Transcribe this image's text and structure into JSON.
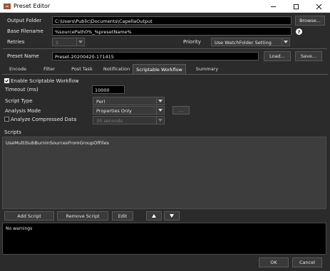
{
  "window": {
    "title": "Preset Editor"
  },
  "form": {
    "output_folder_label": "Output Folder",
    "output_folder_value": "C:\\Users\\Public\\Documents\\CapellaOutput",
    "browse_label": "Browse...",
    "base_filename_label": "Base Filename",
    "base_filename_value": "%sourcePath0%_%presetName%",
    "retries_label": "Retries",
    "retries_value": "2",
    "priority_label": "Priority",
    "priority_value": "Use WatchFolder Setting",
    "preset_name_label": "Preset Name",
    "preset_name_value": "Preset-20200420-171415",
    "load_label": "Load...",
    "save_label": "Save..."
  },
  "tabs": [
    "Encode",
    "Filter",
    "Post Task",
    "Notification",
    "Scriptable Workflow",
    "Summary"
  ],
  "active_tab": "Scriptable Workflow",
  "scriptable": {
    "enable_label": "Enable Scriptable Workflow",
    "enable_checked": true,
    "timeout_label": "Timeout (ms)",
    "timeout_value": "10000",
    "script_type_label": "Script Type",
    "script_type_value": "Perl",
    "analysis_mode_label": "Analysis Mode",
    "analysis_mode_value": "Properties Only",
    "analysis_more_label": "...",
    "analyze_compressed_label": "Analyze Compressed Data",
    "analyze_compressed_checked": false,
    "analyze_duration_value": "30 seconds",
    "scripts_label": "Scripts",
    "scripts": [
      "UseMultiSubBurnInSourcesFromGroupOfFiles"
    ],
    "add_script_label": "Add Script",
    "remove_script_label": "Remove Script",
    "edit_label": "Edit",
    "log_message": "No warnings"
  },
  "footer": {
    "ok_label": "OK",
    "cancel_label": "Cancel"
  },
  "colors": {
    "background": "#2b2b2b",
    "field": "#000000",
    "button": "#3a3a3a",
    "scripts_area": "#3d3d3d"
  }
}
